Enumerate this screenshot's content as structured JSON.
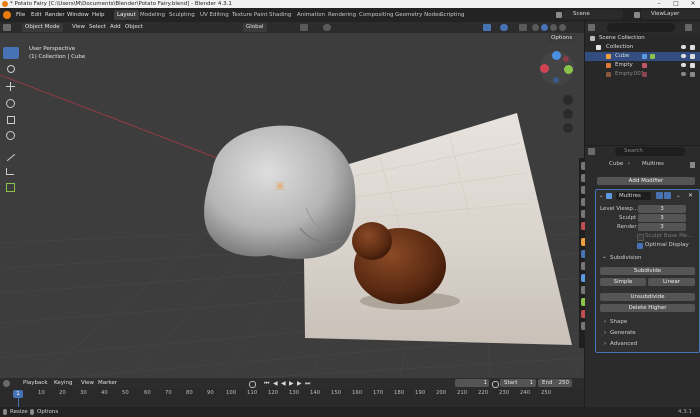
{
  "window": {
    "title": "* Potato Fairy [C:\\Users\\M\\Documents\\Blender\\Potato Fairy.blend] - Blender 4.3.1",
    "controls": [
      "–",
      "□",
      "✕"
    ]
  },
  "menu": [
    "File",
    "Edit",
    "Render",
    "Window",
    "Help"
  ],
  "workspaces": [
    "Layout",
    "Modeling",
    "Sculpting",
    "UV Editing",
    "Texture Paint",
    "Shading",
    "Animation",
    "Rendering",
    "Compositing",
    "Geometry Nodes",
    "Scripting"
  ],
  "active_workspace": "Layout",
  "scene_field": "Scene",
  "view_layer_field": "ViewLayer",
  "viewport_header": {
    "mode": "Object Mode",
    "menus": [
      "View",
      "Select",
      "Add",
      "Object"
    ],
    "transform_orientation": "Global",
    "options_label": "Options"
  },
  "viewport": {
    "perspective_label": "User Perspective",
    "collection_label": "(1) Collection | Cube",
    "gizmo_axes": [
      "X",
      "Y",
      "Z"
    ]
  },
  "outliner": {
    "search_placeholder": "",
    "root": "Scene Collection",
    "collection": "Collection",
    "items": [
      "Cube",
      "Empty",
      "Empty.001"
    ]
  },
  "properties": {
    "search_placeholder": "Search",
    "breadcrumb_object": "Cube",
    "breadcrumb_modifier": "Multires",
    "add_modifier": "Add Modifier",
    "modifier_name": "Multires",
    "level_viewport_label": "Level Viewp...",
    "level_viewport": "3",
    "sculpt_label": "Sculpt",
    "sculpt": "3",
    "render_label": "Render",
    "render": "3",
    "sculpt_base_mesh": "Sculpt Base Me...",
    "optimal_display": "Optimal Display",
    "subdivision_panel": "Subdivision",
    "subdivide": "Subdivide",
    "simple": "Simple",
    "linear": "Linear",
    "unsubdivide": "Unsubdivide",
    "delete_higher": "Delete Higher",
    "shape_panel": "Shape",
    "generate_panel": "Generate",
    "advanced_panel": "Advanced"
  },
  "timeline": {
    "menus": [
      "Playback",
      "Keying",
      "View",
      "Marker"
    ],
    "current_frame": "1",
    "start_label": "Start",
    "start": "1",
    "end_label": "End",
    "end": "250",
    "ticks": [
      "10",
      "20",
      "30",
      "40",
      "50",
      "60",
      "70",
      "80",
      "90",
      "100",
      "110",
      "120",
      "130",
      "140",
      "150",
      "160",
      "170",
      "180",
      "190",
      "200",
      "210",
      "220",
      "230",
      "240",
      "250"
    ],
    "playhead": "1"
  },
  "status": {
    "left_hint": "Resize",
    "right_hint": "Options",
    "version": "4.3.1"
  },
  "colors": {
    "accent": "#4772b3",
    "viewport_bg": "#3d3d3d",
    "x_axis": "#d34452",
    "y_axis": "#8bc34a",
    "z_axis": "#4a90e2"
  }
}
